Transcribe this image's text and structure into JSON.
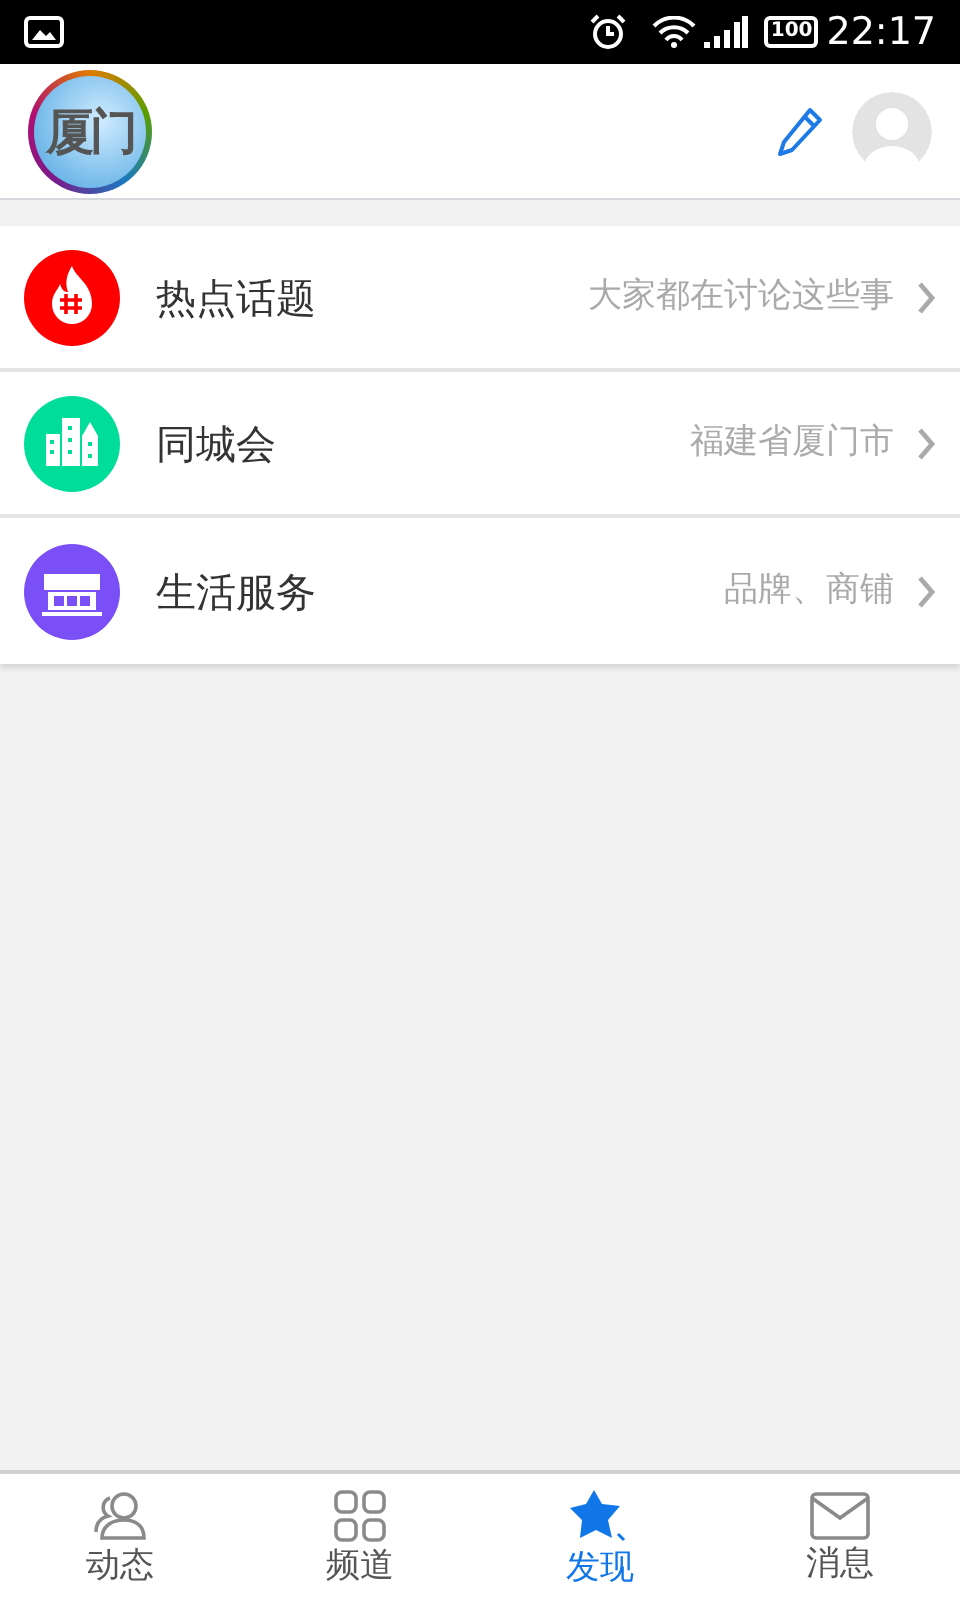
{
  "status_bar": {
    "time": "22:17",
    "battery": "100"
  },
  "header": {
    "logo_text": "厦门"
  },
  "items": [
    {
      "kind": "fire",
      "color": "#ff0000",
      "title": "热点话题",
      "subtitle": "大家都在讨论这些事"
    },
    {
      "kind": "city",
      "color": "#00dd99",
      "title": "同城会",
      "subtitle": "福建省厦门市"
    },
    {
      "kind": "shop",
      "color": "#7b4ff7",
      "title": "生活服务",
      "subtitle": "品牌、商铺"
    }
  ],
  "tabs": [
    {
      "kind": "people",
      "label": "动态",
      "selected": false
    },
    {
      "kind": "grid",
      "label": "频道",
      "selected": false
    },
    {
      "kind": "star",
      "label": "发现",
      "selected": true
    },
    {
      "kind": "mail",
      "label": "消息",
      "selected": false
    }
  ]
}
